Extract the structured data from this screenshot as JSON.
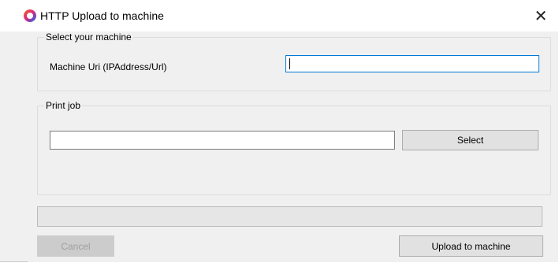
{
  "window": {
    "title": "HTTP Upload to machine",
    "close_glyph": "✕",
    "icon": "app-ring-icon",
    "accent": "#0078d7"
  },
  "machine_group": {
    "legend": "Select your machine",
    "uri_label": "Machine Uri (IPAddress/Url)",
    "uri_value": ""
  },
  "job_group": {
    "legend": "Print job",
    "job_value": "",
    "select_label": "Select"
  },
  "progress": {
    "value": 0
  },
  "footer": {
    "cancel_label": "Cancel",
    "upload_label": "Upload to machine"
  }
}
